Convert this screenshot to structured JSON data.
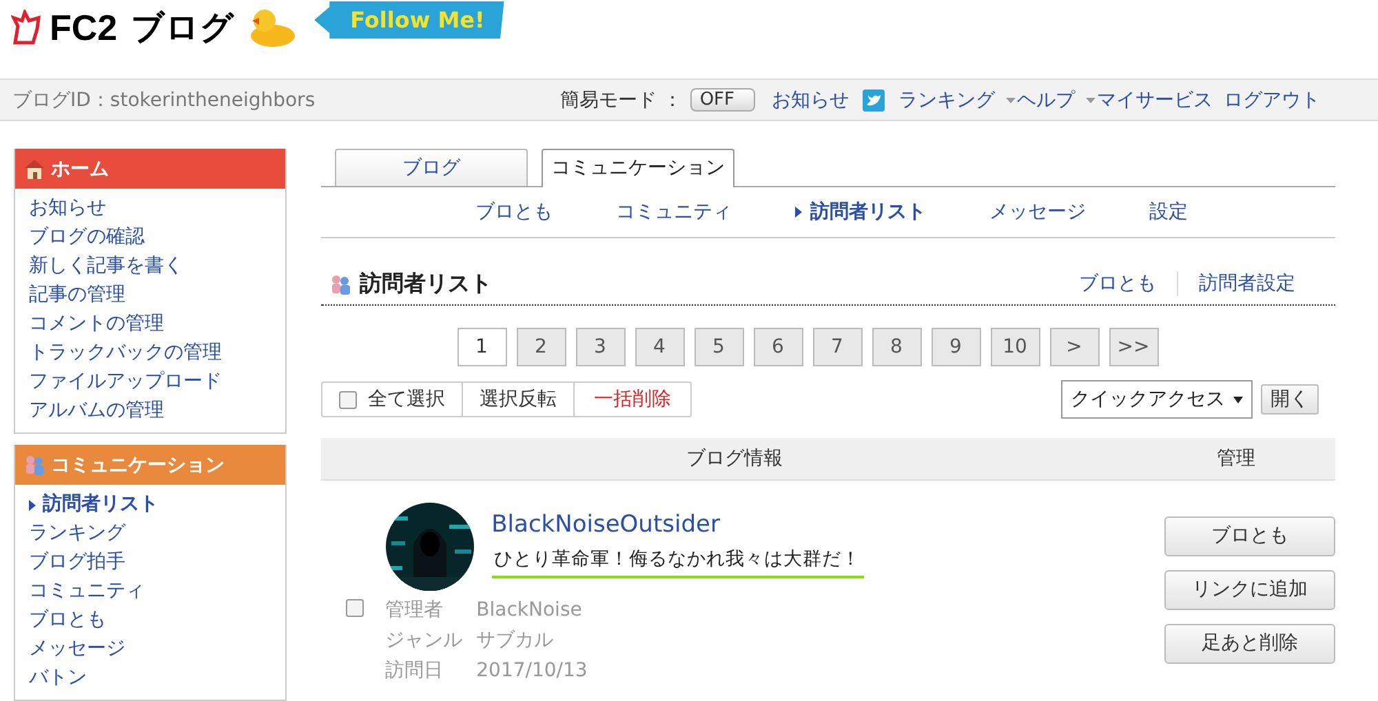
{
  "header": {
    "logo_brand": "FC2",
    "logo_word": "ブログ",
    "follow_button": "Follow Me!"
  },
  "top_bar": {
    "blog_id": "ブログID：stokerintheneighbors",
    "easy_mode_label": "簡易モード ：",
    "easy_mode": {
      "label": "OFF",
      "on": false
    },
    "links": [
      {
        "label": "お知らせ",
        "kind": "plain"
      },
      {
        "label": "ランキング",
        "kind": "twitter"
      },
      {
        "label": "ヘルプ",
        "kind": "menu"
      },
      {
        "label": "マイサービス",
        "kind": "menu"
      },
      {
        "label": "ログアウト",
        "kind": "plain"
      }
    ]
  },
  "sidebar": {
    "sections": [
      {
        "title": "ホーム",
        "kind": "home",
        "color": "#e84c3d",
        "items": [
          {
            "label": "お知らせ",
            "selected": false
          },
          {
            "label": "ブログの確認",
            "selected": false
          },
          {
            "label": "新しく記事を書く",
            "selected": false
          },
          {
            "label": "記事の管理",
            "selected": false
          },
          {
            "label": "コメントの管理",
            "selected": false
          },
          {
            "label": "トラックバックの管理",
            "selected": false
          },
          {
            "label": "ファイルアップロード",
            "selected": false
          },
          {
            "label": "アルバムの管理",
            "selected": false
          }
        ]
      },
      {
        "title": "コミュニケーション",
        "kind": "people",
        "color": "#e8893d",
        "items": [
          {
            "label": "訪問者リスト",
            "selected": true
          },
          {
            "label": "ランキング",
            "selected": false
          },
          {
            "label": "ブログ拍手",
            "selected": false
          },
          {
            "label": "コミュニティ",
            "selected": false
          },
          {
            "label": "ブロとも",
            "selected": false
          },
          {
            "label": "メッセージ",
            "selected": false
          },
          {
            "label": "バトン",
            "selected": false
          }
        ]
      }
    ]
  },
  "tabs": [
    {
      "label": "ブログ",
      "selected": false
    },
    {
      "label": "コミュニケーション",
      "selected": true
    }
  ],
  "subnav": [
    {
      "label": "ブロとも",
      "selected": false
    },
    {
      "label": "コミュニティ",
      "selected": false
    },
    {
      "label": "訪問者リスト",
      "selected": true
    },
    {
      "label": "メッセージ",
      "selected": false
    },
    {
      "label": "設定",
      "selected": false
    }
  ],
  "section": {
    "title": "訪問者リスト",
    "links": [
      "ブロとも",
      "訪問者設定"
    ]
  },
  "pagination": [
    {
      "label": "1",
      "selected": true
    },
    {
      "label": "2",
      "selected": false
    },
    {
      "label": "3",
      "selected": false
    },
    {
      "label": "4",
      "selected": false
    },
    {
      "label": "5",
      "selected": false
    },
    {
      "label": "6",
      "selected": false
    },
    {
      "label": "7",
      "selected": false
    },
    {
      "label": "8",
      "selected": false
    },
    {
      "label": "9",
      "selected": false
    },
    {
      "label": "10",
      "selected": false
    },
    {
      "label": ">",
      "selected": false
    },
    {
      "label": ">>",
      "selected": false
    }
  ],
  "bulk_actions": {
    "select_all": {
      "label": "全て選択",
      "checked": false
    },
    "buttons": [
      {
        "label": "選択反転",
        "kind": "normal"
      },
      {
        "label": "一括削除",
        "kind": "danger"
      }
    ]
  },
  "quick_access": {
    "value": "クイックアクセス",
    "open_button": "開く"
  },
  "table": {
    "columns": [
      "ブログ情報",
      "管理"
    ],
    "rows": [
      {
        "checked": false,
        "blog_name": "BlackNoiseOutsider",
        "tagline": "ひとり革命軍！侮るなかれ我々は大群だ！",
        "details": [
          {
            "label": "管理者",
            "value": "BlackNoise"
          },
          {
            "label": "ジャンル",
            "value": "サブカル"
          },
          {
            "label": "訪問日",
            "value": "2017/10/13"
          }
        ],
        "actions": [
          "ブロとも",
          "リンクに追加",
          "足あと削除"
        ]
      }
    ]
  }
}
